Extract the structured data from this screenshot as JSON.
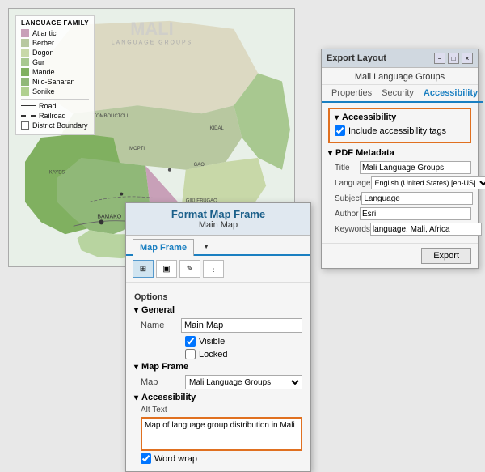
{
  "map": {
    "title": "MALI",
    "subtitle": "LANGUAGE GROUPS",
    "legend_title": "LANGUAGE FAMILY",
    "legend_items": [
      {
        "label": "Atlantic",
        "color": "#c8a0b8"
      },
      {
        "label": "Berber",
        "color": "#b8c8a0"
      },
      {
        "label": "Dogon",
        "color": "#c8d8a8"
      },
      {
        "label": "Gur",
        "color": "#a8c890"
      },
      {
        "label": "Mande",
        "color": "#80b060"
      },
      {
        "label": "Nilo-Saharan",
        "color": "#90b878"
      },
      {
        "label": "Sonike",
        "color": "#b0d090"
      }
    ],
    "legend_lines": [
      {
        "label": "Road"
      },
      {
        "label": "Railroad"
      },
      {
        "label": "District Boundary"
      }
    ]
  },
  "format_dialog": {
    "title": "Format Map Frame",
    "subtitle": "Main Map",
    "tabs": [
      {
        "label": "Map Frame",
        "active": true
      }
    ],
    "toolbar_buttons": [
      "grid-icon",
      "border-icon",
      "edit-icon",
      "options-icon"
    ],
    "options_label": "Options",
    "general_label": "General",
    "name_label": "Name",
    "name_value": "Main Map",
    "visible_label": "Visible",
    "visible_checked": true,
    "locked_label": "Locked",
    "locked_checked": false,
    "map_frame_label": "Map Frame",
    "map_label": "Map",
    "map_value": "Mali Language Groups",
    "accessibility_label": "Accessibility",
    "alt_text_label": "Alt Text",
    "alt_text_value": "Map of language group distribution in Mali",
    "word_wrap_label": "Word wrap",
    "word_wrap_checked": true
  },
  "export_dialog": {
    "title": "Export Layout",
    "subtitle": "Mali Language Groups",
    "tabs": [
      {
        "label": "Properties"
      },
      {
        "label": "Security"
      },
      {
        "label": "Accessibility",
        "active": true
      }
    ],
    "accessibility_section_label": "Accessibility",
    "include_tags_label": "Include accessibility tags",
    "include_tags_checked": true,
    "pdf_metadata_label": "PDF Metadata",
    "title_label": "Title",
    "title_value": "Mali Language Groups",
    "language_label": "Language",
    "language_value": "English (United States) [en-US]",
    "subject_label": "Subject",
    "subject_value": "Language",
    "author_label": "Author",
    "author_value": "Esri",
    "keywords_label": "Keywords",
    "keywords_value": "language, Mali, Africa",
    "export_button": "Export",
    "window_controls": [
      "-",
      "□",
      "×"
    ]
  }
}
